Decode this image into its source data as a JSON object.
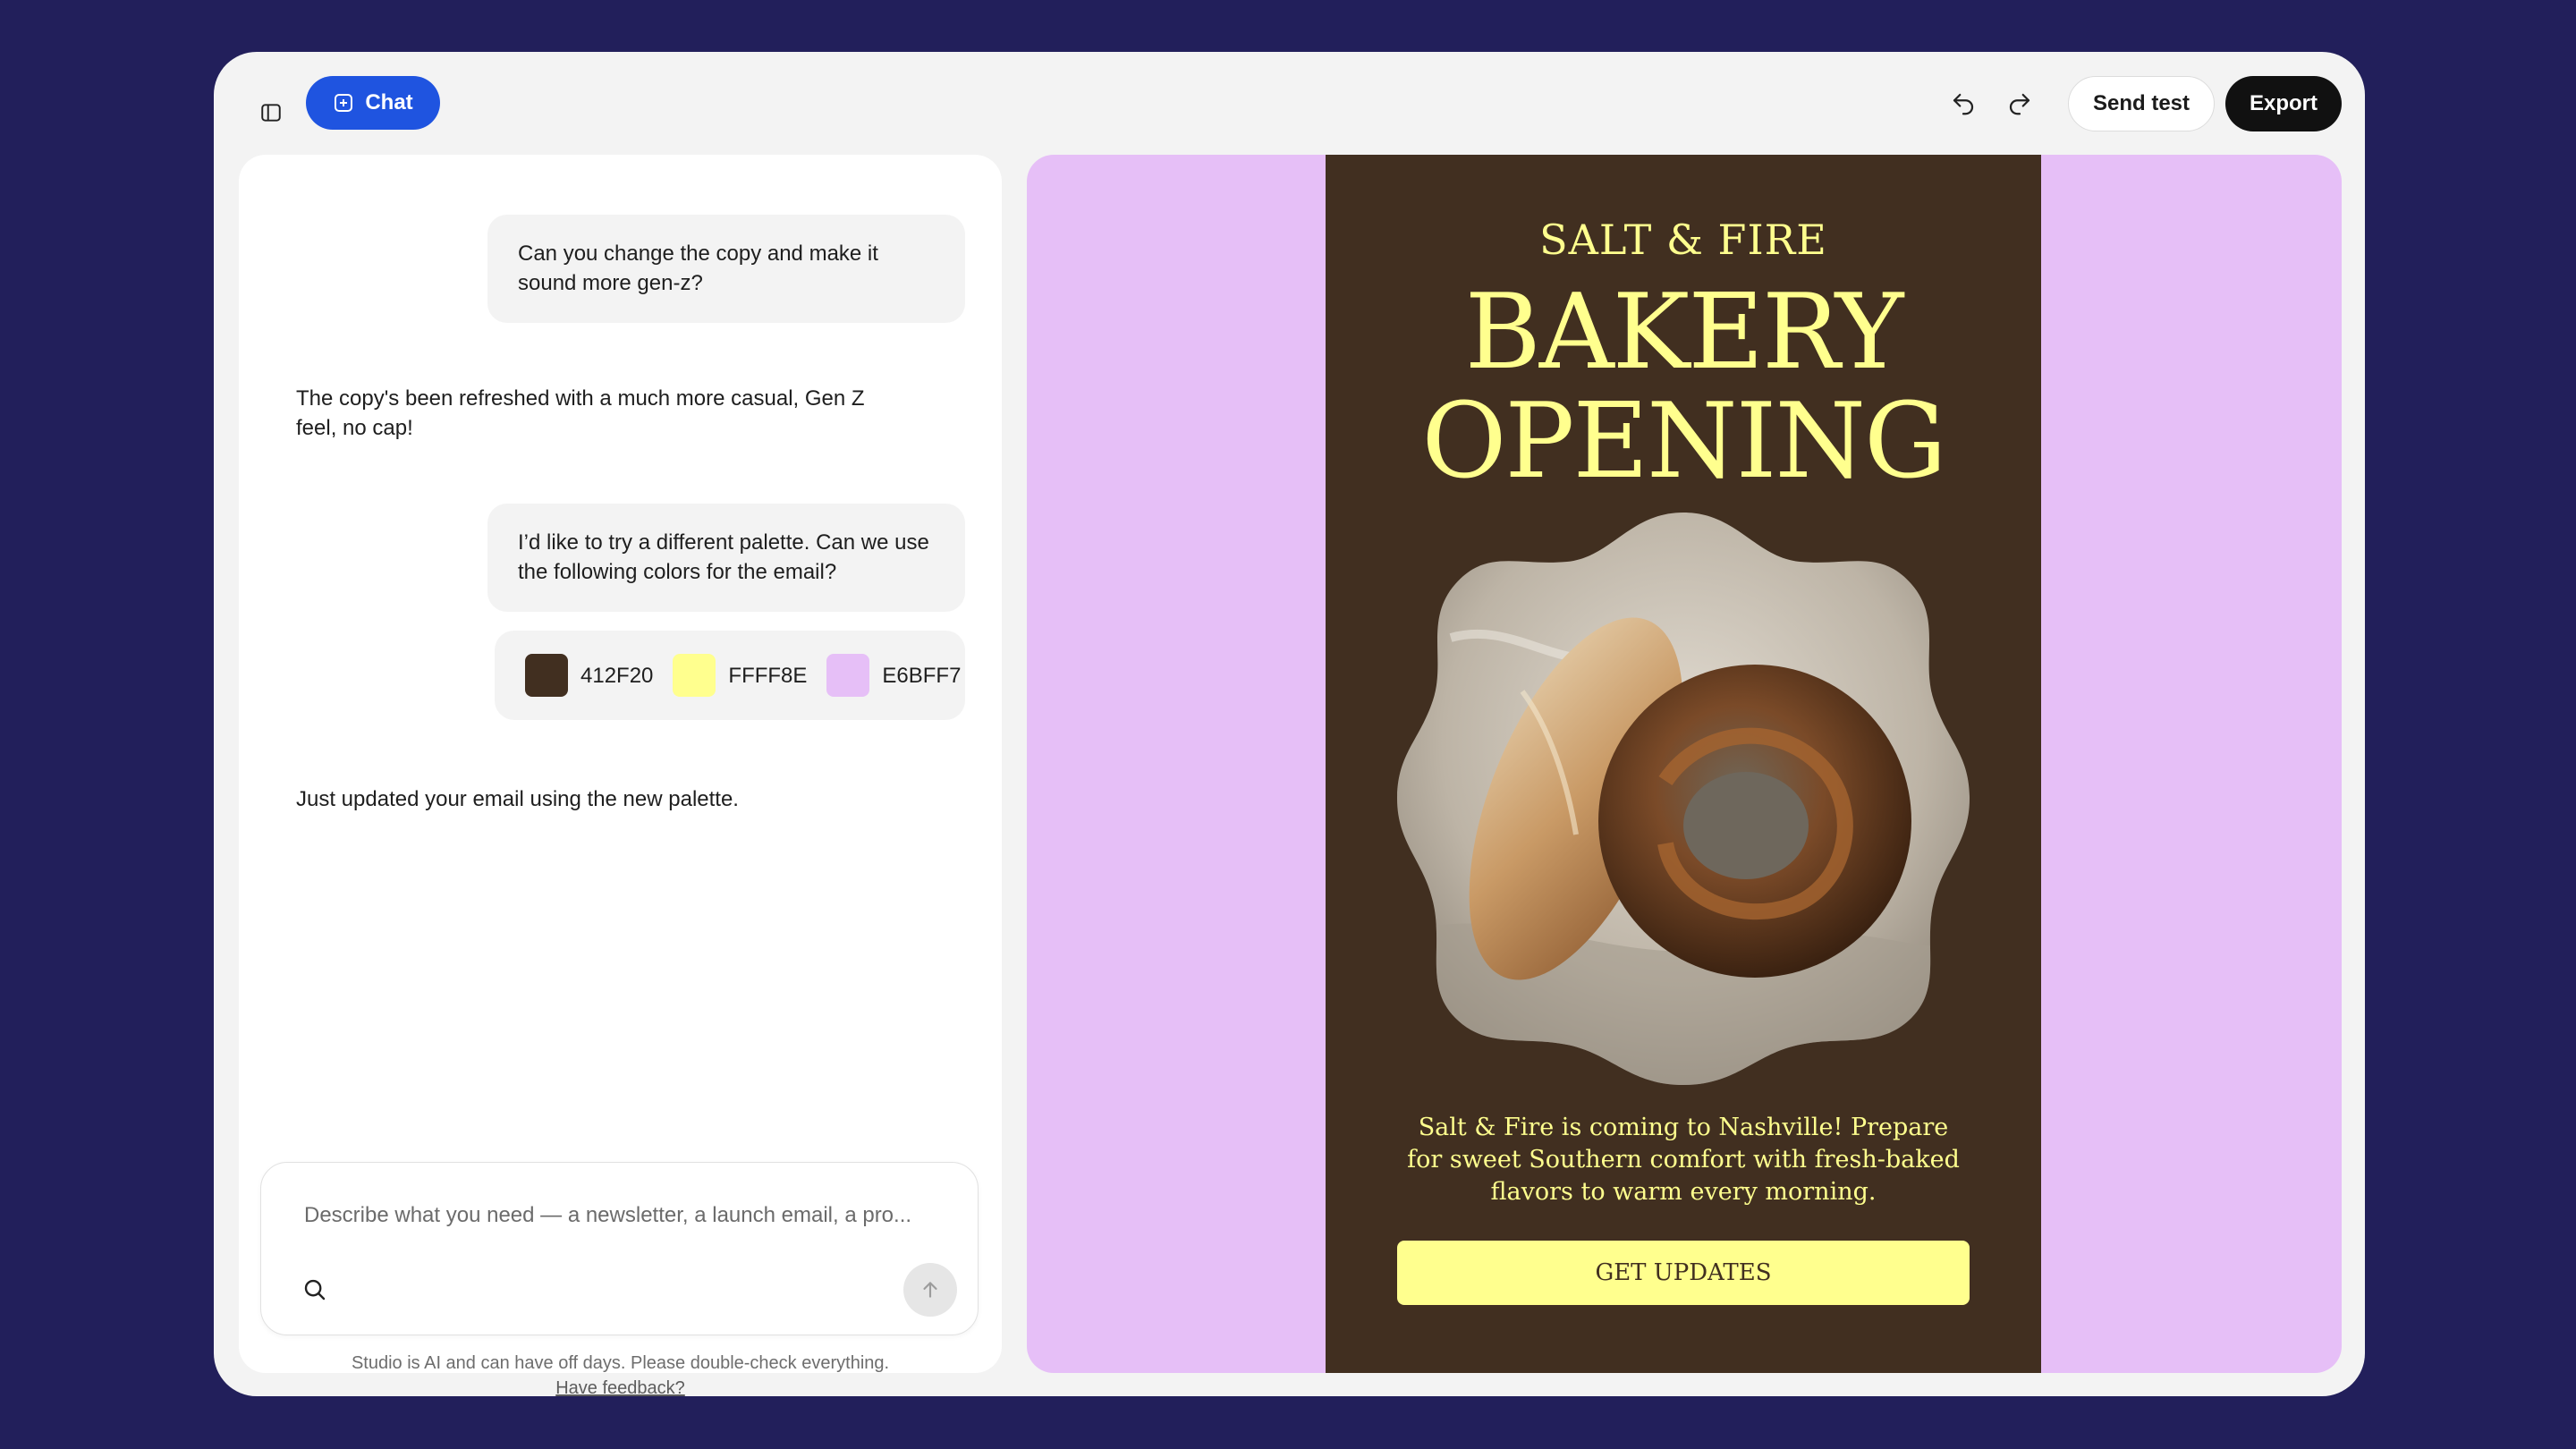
{
  "toolbar": {
    "sidebar_toggle_icon": "sidebar-panel-icon",
    "chat_label": "Chat",
    "chat_icon": "plus-square-icon",
    "undo_icon": "undo-icon",
    "redo_icon": "redo-icon",
    "send_test_label": "Send test",
    "export_label": "Export"
  },
  "chat": {
    "messages": [
      {
        "role": "user",
        "text": "Can you change the copy and make it sound more gen-z?"
      },
      {
        "role": "assistant",
        "text": "The copy's been refreshed with a much more casual, Gen Z feel, no cap!"
      },
      {
        "role": "user",
        "text": "I’d like to try a different palette. Can we use the following colors for the email?"
      },
      {
        "role": "assistant",
        "text": "Just updated your email using the new palette."
      }
    ],
    "palette": [
      {
        "label": "412F20",
        "color": "#412F20"
      },
      {
        "label": "FFFF8E",
        "color": "#FFFF8E"
      },
      {
        "label": "E6BFF7",
        "color": "#E6BFF7"
      }
    ],
    "composer": {
      "placeholder": "Describe what you need — a newsletter, a launch email, a pro...",
      "search_icon": "search-icon",
      "send_icon": "arrow-up-icon"
    },
    "disclaimer": "Studio is AI and can have off days. Please double-check everything.",
    "feedback_link": "Have feedback?"
  },
  "preview": {
    "background_color": "#E6BFF7",
    "email": {
      "background_color": "#412F20",
      "text_color": "#FFFF8E",
      "brand": "SALT & FIRE",
      "headline_line1": "BAKERY",
      "headline_line2": "OPENING",
      "image_icon": "bread-loaves-image",
      "body": "Salt & Fire is coming to Nashville! Prepare for sweet Southern comfort with fresh-baked flavors to warm every morning.",
      "cta_label": "GET UPDATES"
    }
  }
}
